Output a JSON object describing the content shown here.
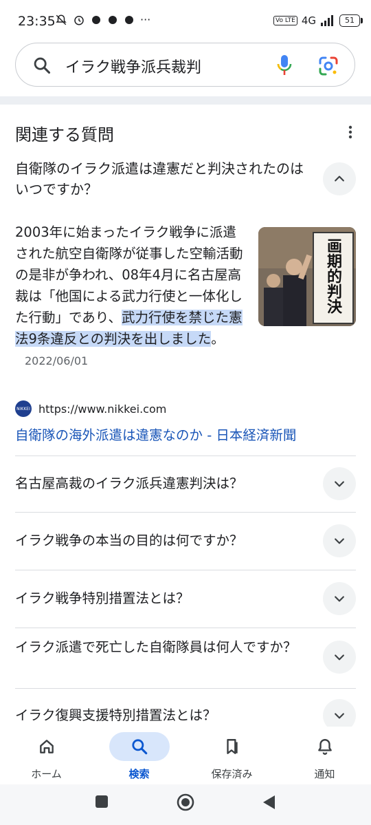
{
  "status_bar": {
    "time": "23:35",
    "icons_left": [
      "bell-off-icon",
      "alarm-icon",
      "app-notification-icon",
      "app-notification-icon",
      "app-notification-icon",
      "more-dots"
    ],
    "network": "4G",
    "volte": "Vo LTE",
    "battery": "51"
  },
  "search": {
    "query": "イラク戦争派兵裁判"
  },
  "related": {
    "title": "関連する質問",
    "open_question": "自衛隊のイラク派遣は違憲だと判決されたのはいつですか？",
    "answer_plain": "2003年に始まったイラク戦争に派遣された航空自衛隊が従事した空輸活動の是非が争われ、08年4月に名古屋高裁は「他国による武力行使と一体化した行動」であり、",
    "answer_highlight": "武力行使を禁じた憲法9条違反との判決を出しました",
    "answer_end": "。",
    "date": "2022/06/01",
    "image_sign_text": "画期的判決",
    "source_url": "https://www.nikkei.com",
    "source_logo_text": "NIKKEI",
    "source_title": "自衛隊の海外派遣は違憲なのか - 日本経済新聞",
    "questions": [
      "名古屋高裁のイラク派兵違憲判決は？",
      "イラク戦争の本当の目的は何ですか？",
      "イラク戦争特別措置法とは？",
      "イラク派遣で死亡した自衛隊員は何人ですか？",
      "イラク復興支援特別措置法とは？"
    ]
  },
  "bottom_nav": {
    "items": [
      {
        "label": "ホーム",
        "icon": "home-icon"
      },
      {
        "label": "検索",
        "icon": "search-icon"
      },
      {
        "label": "保存済み",
        "icon": "bookmark-icon"
      },
      {
        "label": "通知",
        "icon": "bell-icon"
      }
    ],
    "active_index": 1
  },
  "colors": {
    "link": "#1a56b8",
    "highlight": "#c6d9f7",
    "active_nav": "#0b57d0"
  }
}
